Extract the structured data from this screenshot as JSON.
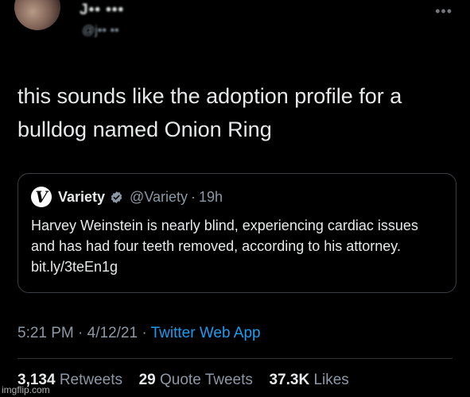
{
  "author": {
    "display_name": "J•• •••",
    "handle": "@j•• ••"
  },
  "more_label": "•••",
  "tweet": {
    "text": "this sounds like the adoption profile for a bulldog named Onion Ring"
  },
  "quoted": {
    "logo_letter": "V",
    "name": "Variety",
    "handle": "@Variety",
    "separator": "·",
    "age": "19h",
    "text": "Harvey Weinstein is nearly blind, experiencing cardiac issues and has had four teeth removed, according to his attorney. bit.ly/3teEn1g",
    "verified_color": "#8b98a5"
  },
  "meta": {
    "time": "5:21 PM",
    "dot": "·",
    "date": "4/12/21",
    "source": "Twitter Web App"
  },
  "stats": {
    "retweets_count": "3,134",
    "retweets_label": "Retweets",
    "quotes_count": "29",
    "quotes_label": "Quote Tweets",
    "likes_count": "37.3K",
    "likes_label": "Likes"
  },
  "watermark": "imgflip.com",
  "colors": {
    "background": "#000000",
    "text": "#e7e9ea",
    "muted": "#8b98a5",
    "link": "#1d9bf0",
    "border": "#3b3f44"
  }
}
